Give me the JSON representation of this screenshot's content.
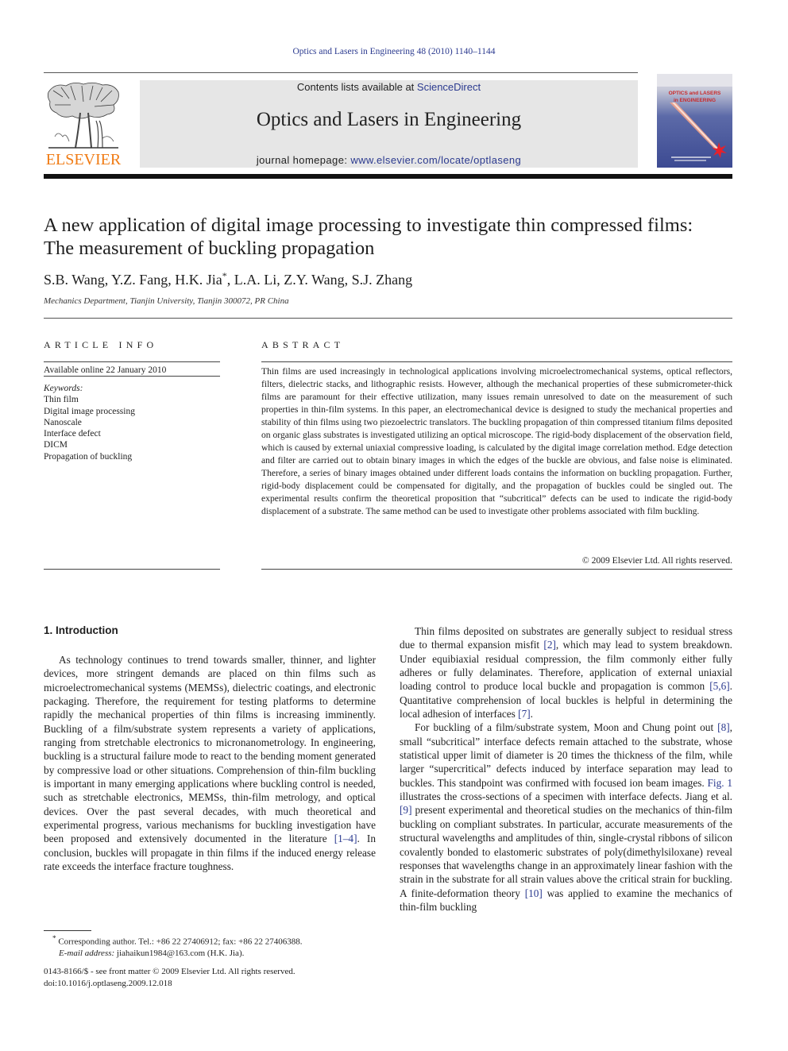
{
  "running_header": "Optics and Lasers in Engineering 48 (2010) 1140–1144",
  "masthead": {
    "publisher_logo_text": "ELSEVIER",
    "contents_prefix": "Contents lists available at ",
    "contents_link": "ScienceDirect",
    "journal_name": "Optics and Lasers in Engineering",
    "homepage_prefix": "journal homepage: ",
    "homepage_link": "www.elsevier.com/locate/optlaseng",
    "cover_title_line1": "OPTICS and LASERS",
    "cover_title_line2": "in ENGINEERING",
    "colors": {
      "elsevier_orange": "#f07b14",
      "link_blue": "#2b3a8f",
      "banner_grey": "#e6e6e6"
    }
  },
  "article": {
    "title": "A new application of digital image processing to investigate thin compressed films: The measurement of buckling propagation",
    "authors_before_star": "S.B. Wang, Y.Z. Fang, H.K. Jia",
    "author_mark": "*",
    "authors_after_star": ", L.A. Li, Z.Y. Wang, S.J. Zhang",
    "affiliation": "Mechanics Department, Tianjin University, Tianjin 300072, PR China"
  },
  "article_info": {
    "label": "ARTICLE INFO",
    "available_online": "Available online 22 January 2010",
    "keywords_label": "Keywords:",
    "keywords": [
      "Thin film",
      "Digital image processing",
      "Nanoscale",
      "Interface defect",
      "DICM",
      "Propagation of buckling"
    ]
  },
  "abstract": {
    "label": "ABSTRACT",
    "text": "Thin films are used increasingly in technological applications involving microelectromechanical systems, optical reflectors, filters, dielectric stacks, and lithographic resists. However, although the mechanical properties of these submicrometer-thick films are paramount for their effective utilization, many issues remain unresolved to date on the measurement of such properties in thin-film systems. In this paper, an electromechanical device is designed to study the mechanical properties and stability of thin films using two piezoelectric translators. The buckling propagation of thin compressed titanium films deposited on organic glass substrates is investigated utilizing an optical microscope. The rigid-body displacement of the observation field, which is caused by external uniaxial compressive loading, is calculated by the digital image correlation method. Edge detection and filter are carried out to obtain binary images in which the edges of the buckle are obvious, and false noise is eliminated. Therefore, a series of binary images obtained under different loads contains the information on buckling propagation. Further, rigid-body displacement could be compensated for digitally, and the propagation of buckles could be singled out. The experimental results confirm the theoretical proposition that “subcritical” defects can be used to indicate the rigid-body displacement of a substrate. The same method can be used to investigate other problems associated with film buckling.",
    "copyright": "© 2009 Elsevier Ltd. All rights reserved."
  },
  "introduction": {
    "heading": "1.  Introduction",
    "p1_a": "As technology continues to trend towards smaller, thinner, and lighter devices, more stringent demands are placed on thin films such as microelectromechanical systems (MEMSs), dielectric coatings, and electronic packaging. Therefore, the requirement for testing platforms to determine rapidly the mechanical properties of thin films is increasing imminently. Buckling of a film/substrate system represents a variety of applications, ranging from stretchable electronics to micronanometrology. In engineering, buckling is a structural failure mode to react to the bending moment generated by compressive load or other situations. Comprehension of thin-film buckling is important in many emerging applications where buckling control is needed, such as stretchable electronics, MEMSs, thin-film metrology, and optical devices. Over the past several decades, with much theoretical and experimental progress, various mechanisms for buckling investigation have been proposed and extensively documented in the literature ",
    "p1_ref": "[1–4]",
    "p1_b": ". In conclusion, buckles will propagate in thin films if the induced energy release rate exceeds the interface fracture toughness.",
    "p2_a": "Thin films deposited on substrates are generally subject to residual stress due to thermal expansion misfit ",
    "p2_ref1": "[2]",
    "p2_b": ", which may lead to system breakdown. Under equibiaxial residual compression, the film commonly either fully adheres or fully delaminates. Therefore, application of external uniaxial loading control to produce local buckle and propagation is common ",
    "p2_ref2": "[5,6]",
    "p2_c": ". Quantitative comprehension of local buckles is helpful in determining the local adhesion of interfaces ",
    "p2_ref3": "[7]",
    "p2_d": ".",
    "p3_a": "For buckling of a film/substrate system, Moon and Chung point out ",
    "p3_ref1": "[8]",
    "p3_b": ", small “subcritical” interface defects remain attached to the substrate, whose statistical upper limit of diameter is 20 times the thickness of the film, while larger “supercritical” defects induced by interface separation may lead to buckles. This standpoint was confirmed with focused ion beam images. ",
    "p3_fig": "Fig. 1",
    "p3_c": " illustrates the cross-sections of a specimen with interface defects. Jiang et al. ",
    "p3_ref2": "[9]",
    "p3_d": " present experimental and theoretical studies on the mechanics of thin-film buckling on compliant substrates. In particular, accurate measurements of the structural wavelengths and amplitudes of thin, single-crystal ribbons of silicon covalently bonded to elastomeric substrates of poly(dimethylsiloxane) reveal responses that wavelengths change in an approximately linear fashion with the strain in the substrate for all strain values above the critical strain for buckling. A finite-deformation theory ",
    "p3_ref3": "[10]",
    "p3_e": " was applied to examine the mechanics of thin-film buckling"
  },
  "footnotes": {
    "star": "*",
    "corresponding": " Corresponding author. Tel.: +86 22 27406912; fax: +86 22 27406388.",
    "email_label": "E-mail address:",
    "email": " jiahaikun1984@163.com (H.K. Jia).",
    "front_matter": "0143-8166/$ - see front matter © 2009 Elsevier Ltd. All rights reserved.",
    "doi": "doi:10.1016/j.optlaseng.2009.12.018"
  }
}
